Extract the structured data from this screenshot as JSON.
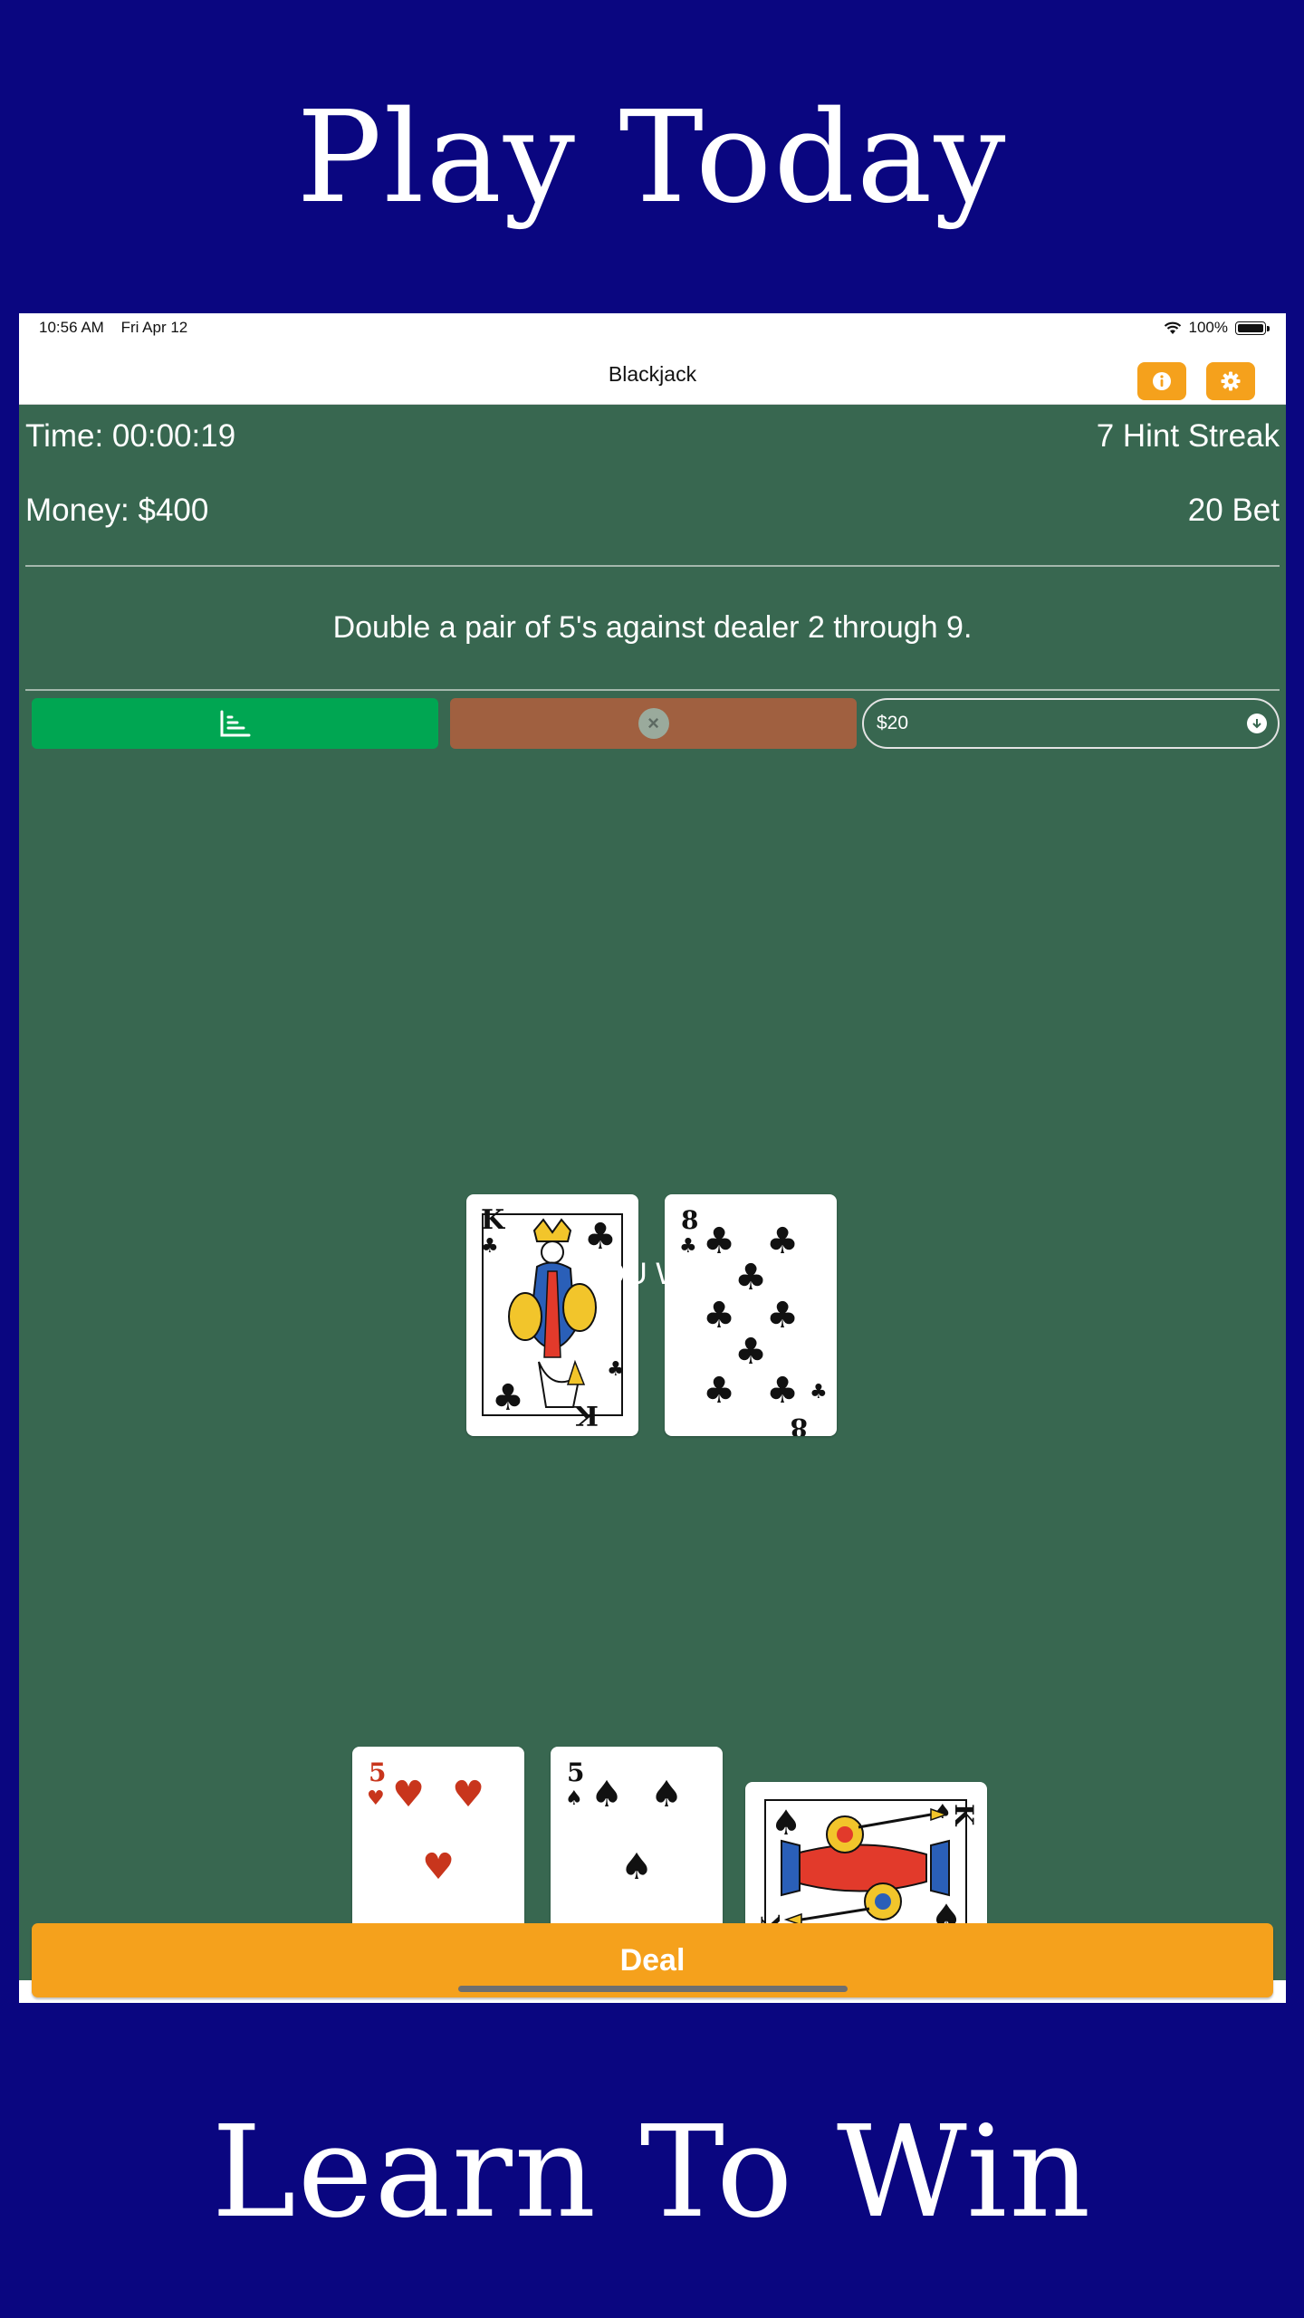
{
  "promo": {
    "top": "Play Today",
    "bottom": "Learn To Win"
  },
  "status_bar": {
    "time": "10:56 AM",
    "date": "Fri Apr 12",
    "battery": "100%"
  },
  "nav": {
    "title": "Blackjack",
    "info_icon": "info-icon",
    "settings_icon": "gear-icon"
  },
  "stats": {
    "time": "Time: 00:00:19",
    "streak": "7 Hint Streak",
    "money": "Money: $400",
    "bet": "20 Bet"
  },
  "hint": "Double a pair of 5's against dealer 2 through 9.",
  "controls": {
    "chart_icon": "chart-icon",
    "clear_icon": "clear-icon",
    "bet_value": "$20"
  },
  "dealer_cards": [
    {
      "rank": "K",
      "suit": "♣",
      "color": "#111111"
    },
    {
      "rank": "8",
      "suit": "♣",
      "color": "#111111"
    }
  ],
  "result": "YOU WIN!",
  "player_cards": [
    {
      "rank": "5",
      "suit": "♥",
      "color": "#c8351c"
    },
    {
      "rank": "5",
      "suit": "♠",
      "color": "#111111"
    },
    {
      "rank": "K",
      "suit": "♠",
      "color": "#111111",
      "rotated": true
    }
  ],
  "deal_label": "Deal",
  "colors": {
    "background": "#0a0680",
    "felt": "#386750",
    "accent": "#f5a11c",
    "chart_button": "#00a652",
    "clear_button": "#a06040"
  }
}
